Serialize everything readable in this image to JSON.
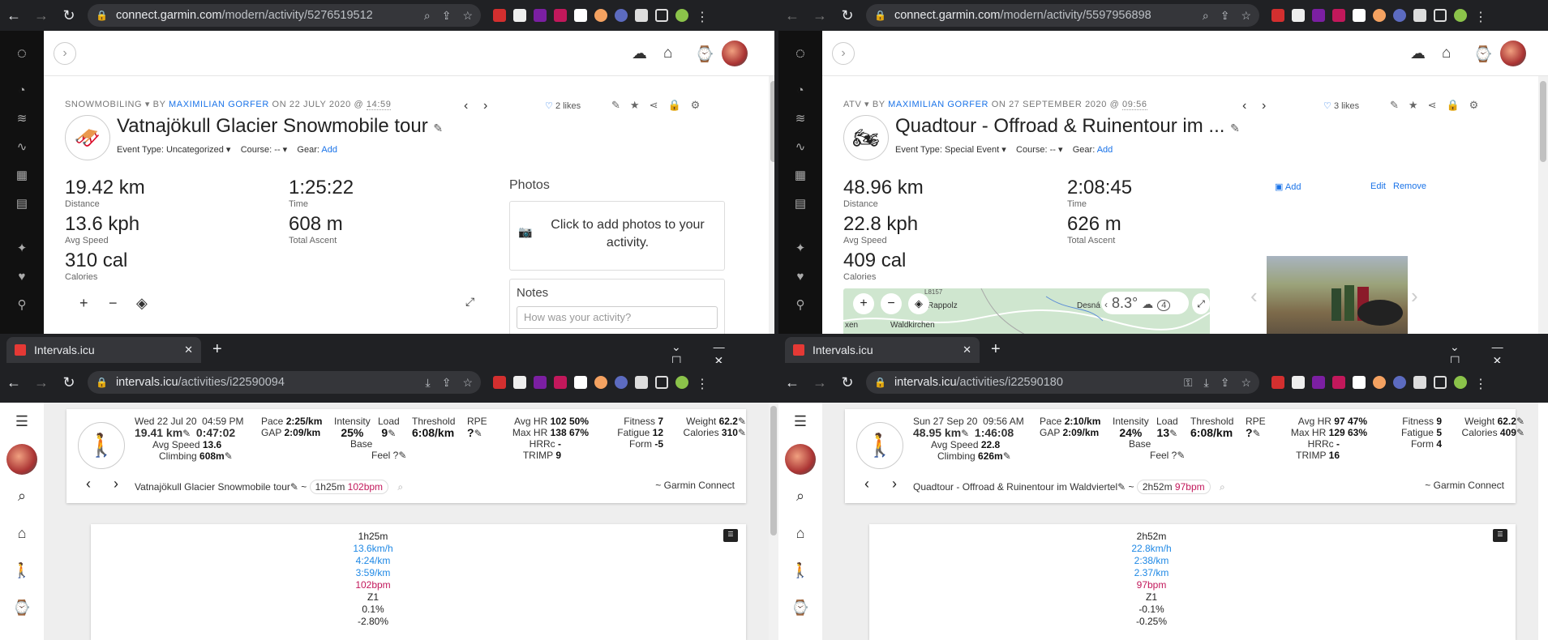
{
  "left_top": {
    "url_host": "connect.garmin.com",
    "url_path": "/modern/activity/5276519512",
    "activity_type": "SNOWMOBILING",
    "by": "BY",
    "author": "MAXIMILIAN GORFER",
    "on": "ON 22 JULY 2020 @",
    "time": "14:59",
    "title": "Vatnajökull Glacier Snowmobile tour",
    "event_type": "Event Type: Uncategorized ▾",
    "course": "Course: -- ▾",
    "gear_label": "Gear:",
    "gear_add": "Add",
    "likes": "2 likes",
    "stats": [
      {
        "value": "19.42 km",
        "label": "Distance"
      },
      {
        "value": "1:25:22",
        "label": "Time"
      },
      {
        "value": "13.6 kph",
        "label": "Avg Speed"
      },
      {
        "value": "608 m",
        "label": "Total Ascent"
      },
      {
        "value": "310 cal",
        "label": "Calories"
      }
    ],
    "photos_title": "Photos",
    "photos_prompt": "Click to add photos to your activity.",
    "notes_title": "Notes",
    "notes_placeholder": "How was your activity?"
  },
  "right_top": {
    "url_host": "connect.garmin.com",
    "url_path": "/modern/activity/5597956898",
    "activity_type": "ATV",
    "by": "BY",
    "author": "MAXIMILIAN GORFER",
    "on": "ON 27 SEPTEMBER 2020 @",
    "time": "09:56",
    "title": "Quadtour - Offroad & Ruinentour im ...",
    "event_type": "Event Type: Special Event ▾",
    "course": "Course: -- ▾",
    "gear_label": "Gear:",
    "gear_add": "Add",
    "likes": "3 likes",
    "stats": [
      {
        "value": "48.96 km",
        "label": "Distance"
      },
      {
        "value": "2:08:45",
        "label": "Time"
      },
      {
        "value": "22.8 kph",
        "label": "Avg Speed"
      },
      {
        "value": "626 m",
        "label": "Total Ascent"
      },
      {
        "value": "409 cal",
        "label": "Calories"
      }
    ],
    "photo_add": "Add",
    "photo_edit": "Edit",
    "photo_remove": "Remove",
    "map_labels": [
      "Rappolz",
      "Waldkirchen",
      "Desná",
      "L8157",
      "xen"
    ],
    "weather_temp": "8.3°",
    "weather_badge": "4"
  },
  "left_bottom": {
    "tab_title": "Intervals.icu",
    "url_host": "intervals.icu",
    "url_path": "/activities/i22590094",
    "date": "Wed 22 Jul 20",
    "clock": "04:59 PM",
    "distance": "19.41 km",
    "duration": "0:47:02",
    "avg_speed_label": "Avg Speed",
    "avg_speed": "13.6",
    "climbing_label": "Climbing",
    "climbing": "608m",
    "pace_label": "Pace",
    "pace": "2:25/km",
    "gap_label": "GAP",
    "gap": "2:09/km",
    "intensity_label": "Intensity",
    "intensity": "25%",
    "load_label": "Load",
    "load": "9",
    "base": "Base",
    "feel": "Feel ?",
    "threshold_label": "Threshold",
    "threshold": "6:08/km",
    "rpe_label": "RPE",
    "rpe": "?",
    "avg_hr_label": "Avg HR",
    "avg_hr": "102",
    "avg_hr_pct": "50%",
    "max_hr_label": "Max HR",
    "max_hr": "138",
    "max_hr_pct": "67%",
    "hrrc_label": "HRRc",
    "hrrc": "-",
    "trimp_label": "TRIMP",
    "trimp": "9",
    "fitness_label": "Fitness",
    "fitness": "7",
    "fatigue_label": "Fatigue",
    "fatigue": "12",
    "form_label": "Form",
    "form": "-5",
    "weight_label": "Weight",
    "weight": "62.2",
    "calories_label": "Calories",
    "calories": "310",
    "name": "Vatnajökull Glacier Snowmobile tour",
    "tilde": "~",
    "pill_time": "1h25m",
    "pill_hr": "102bpm",
    "source": "~ Garmin Connect",
    "seg": [
      "1h25m",
      "13.6km/h",
      "4:24/km",
      "3:59/km",
      "102bpm",
      "Z1",
      "0.1%",
      "-2.80%"
    ]
  },
  "right_bottom": {
    "tab_title": "Intervals.icu",
    "url_host": "intervals.icu",
    "url_path": "/activities/i22590180",
    "date": "Sun 27 Sep 20",
    "clock": "09:56 AM",
    "distance": "48.95 km",
    "duration": "1:46:08",
    "avg_speed_label": "Avg Speed",
    "avg_speed": "22.8",
    "climbing_label": "Climbing",
    "climbing": "626m",
    "pace_label": "Pace",
    "pace": "2:10/km",
    "gap_label": "GAP",
    "gap": "2:09/km",
    "intensity_label": "Intensity",
    "intensity": "24%",
    "load_label": "Load",
    "load": "13",
    "base": "Base",
    "feel": "Feel ?",
    "threshold_label": "Threshold",
    "threshold": "6:08/km",
    "rpe_label": "RPE",
    "rpe": "?",
    "avg_hr_label": "Avg HR",
    "avg_hr": "97",
    "avg_hr_pct": "47%",
    "max_hr_label": "Max HR",
    "max_hr": "129",
    "max_hr_pct": "63%",
    "hrrc_label": "HRRc",
    "hrrc": "-",
    "trimp_label": "TRIMP",
    "trimp": "16",
    "fitness_label": "Fitness",
    "fitness": "9",
    "fatigue_label": "Fatigue",
    "fatigue": "5",
    "form_label": "Form",
    "form": "4",
    "weight_label": "Weight",
    "weight": "62.2",
    "calories_label": "Calories",
    "calories": "409",
    "name": "Quadtour - Offroad & Ruinentour im Waldviertel",
    "tilde": "~",
    "pill_time": "2h52m",
    "pill_hr": "97bpm",
    "source": "~ Garmin Connect",
    "seg": [
      "2h52m",
      "22.8km/h",
      "2:38/km",
      "2.37/km",
      "97bpm",
      "Z1",
      "-0.1%",
      "-0.25%"
    ]
  },
  "colors": {
    "chrome_dark": "#202124",
    "garmin_link": "#1a73e8",
    "icu_red": "#c2185b",
    "icu_blue": "#1e88e5"
  }
}
